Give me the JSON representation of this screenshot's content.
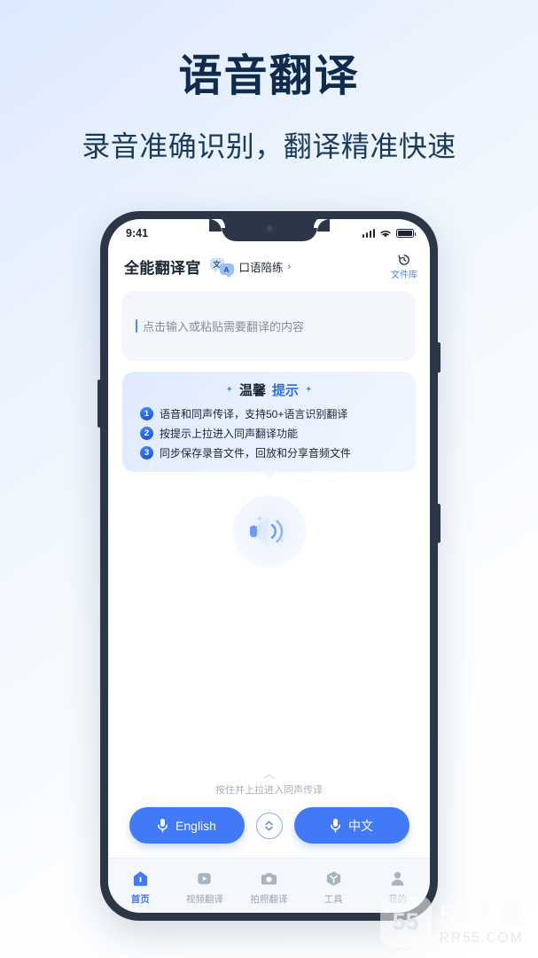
{
  "promo": {
    "headline": "语音翻译",
    "subhead": "录音准确识别，翻译精准快速"
  },
  "colors": {
    "accent": "#4279f6",
    "accent_dark": "#1550d8",
    "headline": "#0f2c4d",
    "frame": "#2b3646",
    "tab_active": "#4279f6",
    "tab_inactive": "#9aa4b2"
  },
  "status_bar": {
    "time": "9:41",
    "icons": [
      "signal-bars-icon",
      "wifi-icon",
      "battery-icon"
    ]
  },
  "app_header": {
    "title": "全能翻译官",
    "badge": {
      "bubble_cn": "文",
      "bubble_en": "A",
      "label": "口语陪练",
      "arrow": "›"
    },
    "file_library": {
      "icon": "history-icon",
      "label": "文件库"
    }
  },
  "input": {
    "placeholder": "点击输入或粘贴需要翻译的内容"
  },
  "tips": {
    "sparkle": "✦",
    "title_part1": "温馨",
    "title_part2": "提示",
    "items": [
      {
        "num": "1",
        "text": "语音和同声传译，支持50+语言识别翻译"
      },
      {
        "num": "2",
        "text": "按提示上拉进入同声翻译功能"
      },
      {
        "num": "3",
        "text": "同步保存录音文件，回放和分享音频文件"
      }
    ]
  },
  "illustration": {
    "icon": "speaker-icon"
  },
  "pull_hint": {
    "chevron": "︿",
    "text": "按住并上拉进入同声传译"
  },
  "language_bar": {
    "left": {
      "icon": "microphone-icon",
      "label": "English"
    },
    "swap": {
      "icon": "swap-vertical-icon"
    },
    "right": {
      "icon": "microphone-icon",
      "label": "中文"
    }
  },
  "tab_bar": {
    "items": [
      {
        "icon": "home-icon",
        "label": "首页",
        "active": true
      },
      {
        "icon": "video-icon",
        "label": "视频翻译",
        "active": false
      },
      {
        "icon": "camera-icon",
        "label": "拍照翻译",
        "active": false
      },
      {
        "icon": "tools-icon",
        "label": "工具",
        "active": false
      },
      {
        "icon": "user-icon",
        "label": "我的",
        "active": false
      }
    ]
  },
  "watermark": {
    "logo": "55",
    "line1": "55下载",
    "line2": "RR55.COM"
  }
}
